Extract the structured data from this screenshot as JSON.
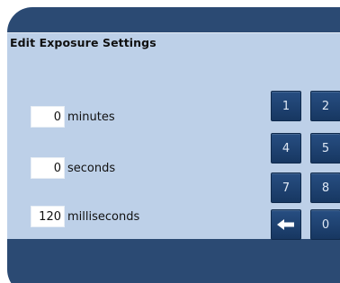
{
  "dialog": {
    "title": "Edit Exposure Settings"
  },
  "fields": [
    {
      "value": "0",
      "unit": "minutes"
    },
    {
      "value": "0",
      "unit": "seconds"
    },
    {
      "value": "120",
      "unit": "milliseconds"
    }
  ],
  "keypad": {
    "keys": [
      "1",
      "2",
      "4",
      "5",
      "7",
      "8",
      "0"
    ],
    "backspace_icon": "arrow-left-icon"
  },
  "colors": {
    "frame": "#2b4a73",
    "panel": "#bdd0e8",
    "key": "#1f4677"
  }
}
